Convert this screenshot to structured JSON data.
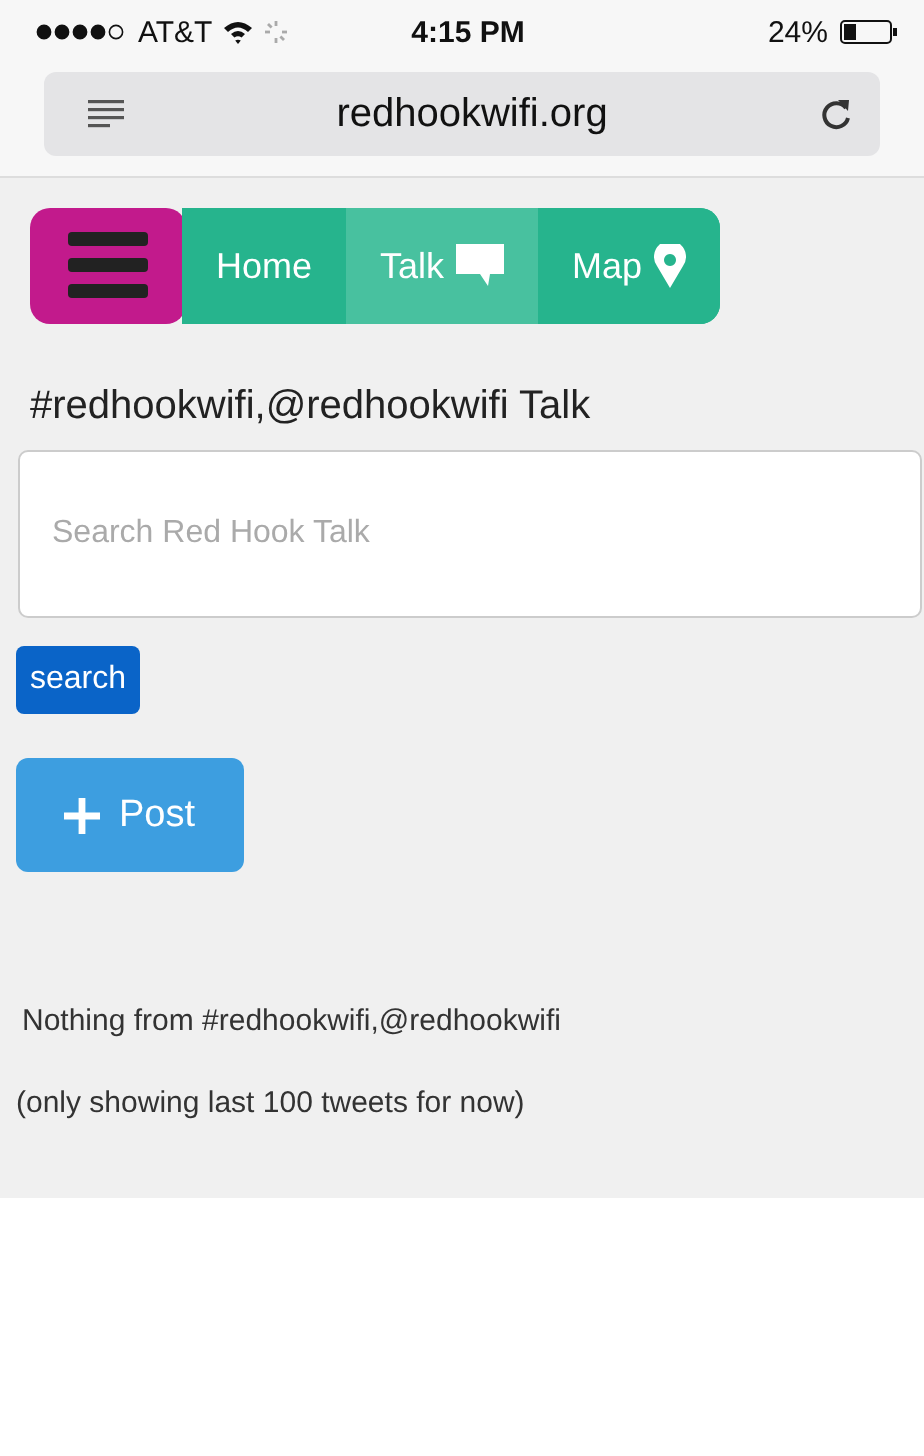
{
  "status_bar": {
    "carrier": "AT&T",
    "time": "4:15 PM",
    "battery": "24%"
  },
  "address_bar": {
    "url": "redhookwifi.org"
  },
  "nav": {
    "tabs": [
      {
        "label": "Home",
        "kind": "plain",
        "selected": false
      },
      {
        "label": "Talk",
        "kind": "chat",
        "selected": true
      },
      {
        "label": "Map",
        "kind": "pin",
        "selected": false
      }
    ]
  },
  "heading": "#redhookwifi,@redhookwifi Talk",
  "search": {
    "placeholder": "Search Red Hook Talk",
    "button": "search"
  },
  "post_button": "Post",
  "messages": [
    "Nothing from #redhookwifi,@redhookwifi",
    "(only showing last 100 tweets for now)"
  ]
}
